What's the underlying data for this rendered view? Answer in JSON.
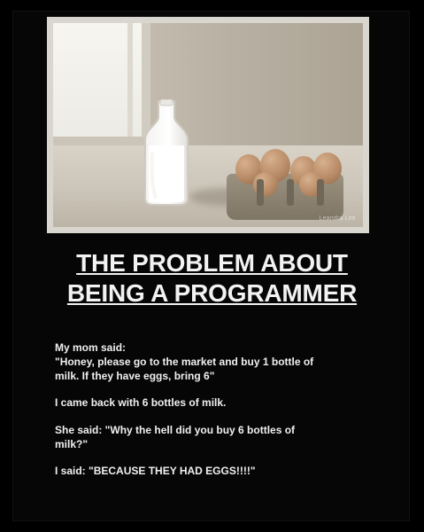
{
  "poster": {
    "photo": {
      "watermark": "Leandra Lee"
    },
    "title_lines": [
      "THE PROBLEM ABOUT",
      "BEING A PROGRAMMER"
    ],
    "paragraphs": [
      {
        "lines": [
          "My mom said:",
          "\"Honey, please go to the market and buy 1 bottle of",
          "milk. If they have eggs, bring 6\""
        ]
      },
      {
        "lines": [
          "I came back with 6 bottles of milk."
        ]
      },
      {
        "lines": [
          "She said: \"Why the hell did you buy 6 bottles of",
          "milk?\""
        ]
      },
      {
        "lines": [
          "I said: \"BECAUSE THEY HAD EGGS!!!!\""
        ]
      }
    ]
  },
  "colors": {
    "background": "#000000",
    "text": "#f2f2f2",
    "photo_border": "#d9d6cf"
  }
}
